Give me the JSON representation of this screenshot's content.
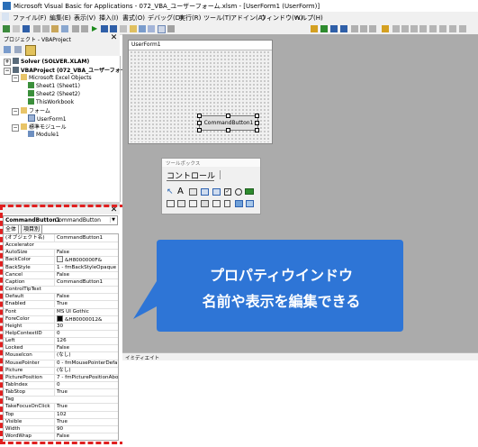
{
  "window": {
    "title": "Microsoft Visual Basic for Applications - 072_VBA_ユーザーフォーム.xlsm - [UserForm1 (UserForm)]"
  },
  "menu": [
    "ファイル(F)",
    "編集(E)",
    "表示(V)",
    "挿入(I)",
    "書式(O)",
    "デバッグ(D)",
    "実行(R)",
    "ツール(T)",
    "アドイン(A)",
    "ウィンドウ(W)",
    "ヘルプ(H)"
  ],
  "project": {
    "title": "プロジェクト - VBAProject",
    "tree": {
      "solver": "Solver (SOLVER.XLAM)",
      "vbaproject": "VBAProject (072_VBA_ユーザーフォー",
      "excel_objects": "Microsoft Excel Objects",
      "sheet1": "Sheet1 (Sheet1)",
      "sheet2": "Sheet2 (Sheet2)",
      "thisworkbook": "ThisWorkbook",
      "forms": "フォーム",
      "userform1": "UserForm1",
      "modules": "標準モジュール",
      "module1": "Module1"
    }
  },
  "properties": {
    "object_name": "CommandButton1",
    "object_type": "CommandButton",
    "tabs": [
      "全体",
      "項目別"
    ],
    "rows": [
      {
        "k": "(オブジェクト名)",
        "v": "CommandButton1"
      },
      {
        "k": "Accelerator",
        "v": ""
      },
      {
        "k": "AutoSize",
        "v": "False"
      },
      {
        "k": "BackColor",
        "v": "&H8000000F&"
      },
      {
        "k": "BackStyle",
        "v": "1 - fmBackStyleOpaque"
      },
      {
        "k": "Cancel",
        "v": "False"
      },
      {
        "k": "Caption",
        "v": "CommandButton1"
      },
      {
        "k": "ControlTipText",
        "v": ""
      },
      {
        "k": "Default",
        "v": "False"
      },
      {
        "k": "Enabled",
        "v": "True"
      },
      {
        "k": "Font",
        "v": "MS UI Gothic"
      },
      {
        "k": "ForeColor",
        "v": "&H80000012&"
      },
      {
        "k": "Height",
        "v": "30"
      },
      {
        "k": "HelpContextID",
        "v": "0"
      },
      {
        "k": "Left",
        "v": "126"
      },
      {
        "k": "Locked",
        "v": "False"
      },
      {
        "k": "MouseIcon",
        "v": "(なし)"
      },
      {
        "k": "MousePointer",
        "v": "0 - fmMousePointerDefault"
      },
      {
        "k": "Picture",
        "v": "(なし)"
      },
      {
        "k": "PicturePosition",
        "v": "7 - fmPicturePositionAbove"
      },
      {
        "k": "TabIndex",
        "v": "0"
      },
      {
        "k": "TabStop",
        "v": "True"
      },
      {
        "k": "Tag",
        "v": ""
      },
      {
        "k": "TakeFocusOnClick",
        "v": "True"
      },
      {
        "k": "Top",
        "v": "102"
      },
      {
        "k": "Visible",
        "v": "True"
      },
      {
        "k": "Width",
        "v": "90"
      },
      {
        "k": "WordWrap",
        "v": "False"
      }
    ],
    "colors": {
      "backcolor": "#f0f0f0",
      "forecolor": "#000000"
    }
  },
  "form": {
    "title": "UserForm1",
    "button_caption": "CommandButton1"
  },
  "toolbox": {
    "title": "ツールボックス",
    "tab": "コントロール"
  },
  "immediate": {
    "title": "イミディエイト"
  },
  "callout": {
    "line1": "プロパティウインドウ",
    "line2": "名前や表示を編集できる",
    "color": "#2e75d6"
  },
  "highlight_color": "#e02020"
}
